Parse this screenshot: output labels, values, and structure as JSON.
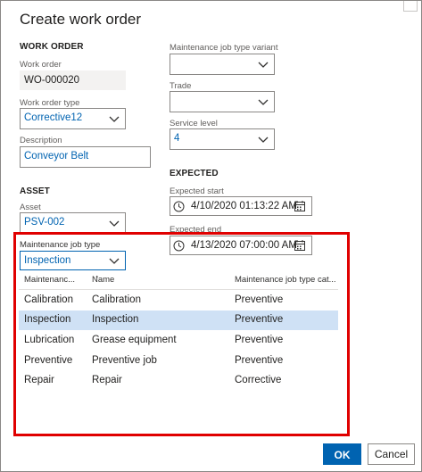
{
  "dialog": {
    "title": "Create work order"
  },
  "work_order_section": {
    "heading": "WORK ORDER",
    "work_order_label": "Work order",
    "work_order_value": "WO-000020",
    "type_label": "Work order type",
    "type_value": "Corrective12",
    "description_label": "Description",
    "description_value": "Conveyor Belt"
  },
  "right_column": {
    "variant_label": "Maintenance job type variant",
    "variant_value": "",
    "trade_label": "Trade",
    "trade_value": "",
    "service_level_label": "Service level",
    "service_level_value": "4"
  },
  "asset_section": {
    "heading": "ASSET",
    "asset_label": "Asset",
    "asset_value": "PSV-002",
    "job_type_label": "Maintenance job type",
    "job_type_value": "Inspection"
  },
  "expected_section": {
    "heading": "EXPECTED",
    "start_label": "Expected start",
    "start_value": "4/10/2020 01:13:22 AM",
    "end_label": "Expected end",
    "end_value": "4/13/2020 07:00:00 AM"
  },
  "lookup_grid": {
    "columns": [
      "Maintenanc...",
      "Name",
      "Maintenance job type cat..."
    ],
    "sort_indicator": "↑",
    "rows": [
      {
        "id": "Calibration",
        "name": "Calibration",
        "category": "Preventive",
        "selected": false
      },
      {
        "id": "Inspection",
        "name": "Inspection",
        "category": "Preventive",
        "selected": true
      },
      {
        "id": "Lubrication",
        "name": "Grease equipment",
        "category": "Preventive",
        "selected": false
      },
      {
        "id": "Preventive",
        "name": "Preventive job",
        "category": "Preventive",
        "selected": false
      },
      {
        "id": "Repair",
        "name": "Repair",
        "category": "Corrective",
        "selected": false
      }
    ]
  },
  "footer": {
    "ok_label": "OK",
    "cancel_label": "Cancel"
  },
  "colors": {
    "accent": "#0063b1",
    "selected_row": "#cfe1f5",
    "highlight": "#e00000"
  }
}
